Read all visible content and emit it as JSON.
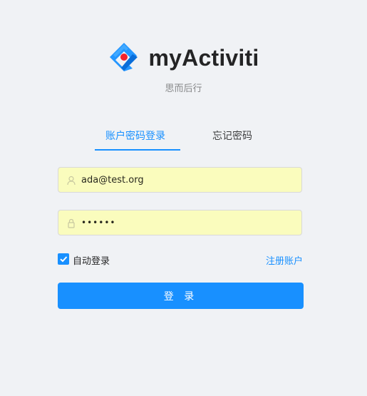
{
  "app": {
    "title": "myActiviti",
    "subtitle": "思而后行"
  },
  "tabs": [
    {
      "label": "账户密码登录",
      "active": true
    },
    {
      "label": "忘记密码",
      "active": false
    }
  ],
  "form": {
    "username": {
      "value": "ada@test.org",
      "icon": "user-icon"
    },
    "password": {
      "masked_value": "••••••",
      "icon": "lock-icon"
    },
    "auto_login": {
      "label": "自动登录",
      "checked": true
    },
    "register_label": "注册账户",
    "submit_label": "登 录"
  },
  "colors": {
    "primary": "#1890ff",
    "background": "#f0f2f5",
    "autofill": "#fafcbd",
    "logo_red": "#f5222d"
  }
}
